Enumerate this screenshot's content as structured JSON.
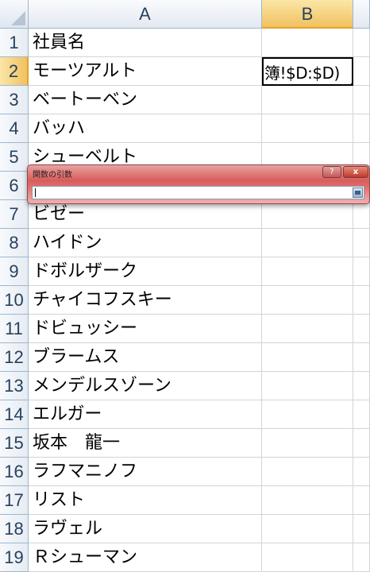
{
  "columns": [
    "A",
    "B"
  ],
  "active_column": "B",
  "active_row": "2",
  "formula_cell_text": "簿!$D:$D)",
  "rows": [
    {
      "num": "1",
      "a": "社員名"
    },
    {
      "num": "2",
      "a": "モーツアルト"
    },
    {
      "num": "3",
      "a": "ベートーベン"
    },
    {
      "num": "4",
      "a": "バッハ"
    },
    {
      "num": "5",
      "a": "シューベルト"
    },
    {
      "num": "6",
      "a": ""
    },
    {
      "num": "7",
      "a": "ビゼー"
    },
    {
      "num": "8",
      "a": "ハイドン"
    },
    {
      "num": "9",
      "a": "ドボルザーク"
    },
    {
      "num": "10",
      "a": "チャイコフスキー"
    },
    {
      "num": "11",
      "a": "ドビュッシー"
    },
    {
      "num": "12",
      "a": "ブラームス"
    },
    {
      "num": "13",
      "a": "メンデルスゾーン"
    },
    {
      "num": "14",
      "a": "エルガー"
    },
    {
      "num": "15",
      "a": "坂本　龍一"
    },
    {
      "num": "16",
      "a": "ラフマニノフ"
    },
    {
      "num": "17",
      "a": "リスト"
    },
    {
      "num": "18",
      "a": "ラヴェル"
    },
    {
      "num": "19",
      "a": "Ｒシューマン"
    }
  ],
  "dialog": {
    "title": "関数の引数",
    "help_label": "?",
    "close_label": "x",
    "input_value": "",
    "collapse_icon": "collapse-dialog-icon"
  }
}
